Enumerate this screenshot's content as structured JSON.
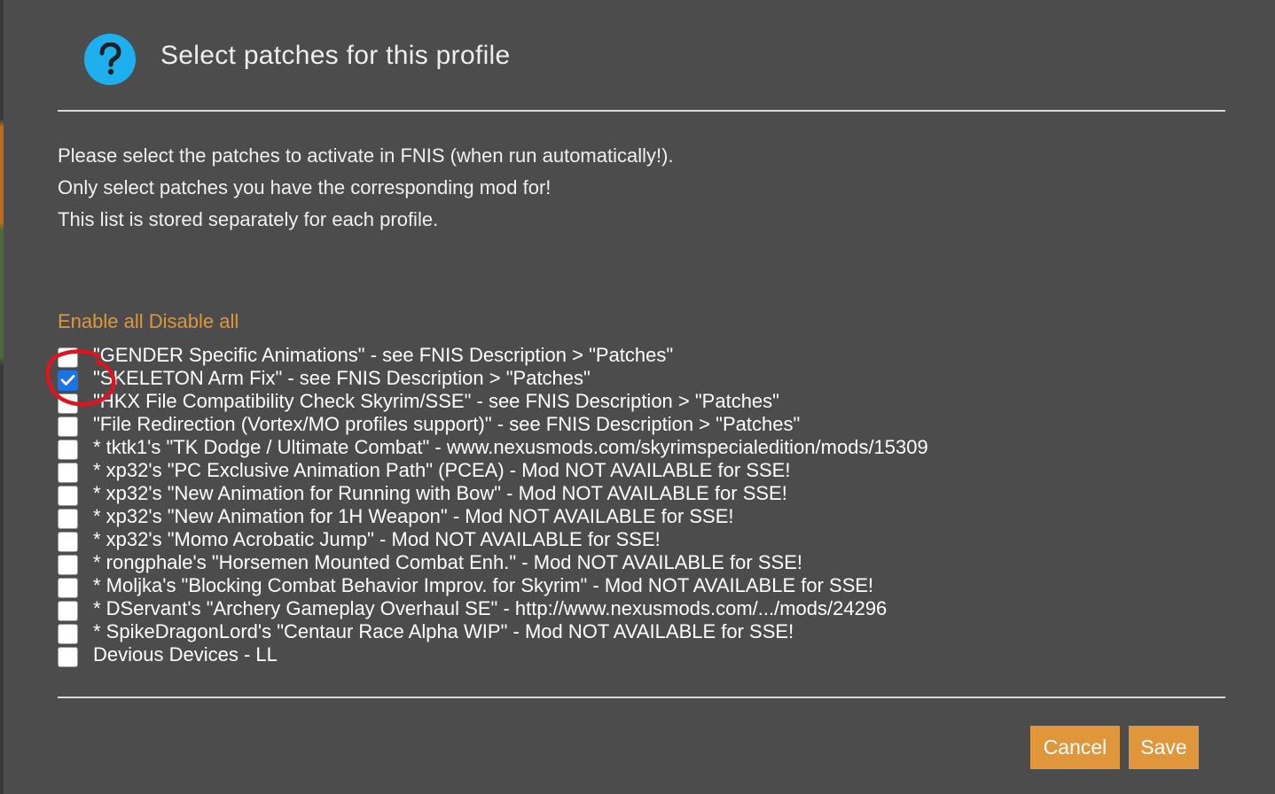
{
  "dialog": {
    "title": "Select patches for this profile",
    "icon": "question-mark-icon",
    "accent_color": "#1eb0ee"
  },
  "description": {
    "line1": "Please select the patches to activate in FNIS (when run automatically!).",
    "line2": "Only select patches you have the corresponding mod for!",
    "line3": "This list is stored separately for each profile."
  },
  "links": {
    "enable_all": "Enable all",
    "disable_all": "Disable all",
    "color": "#e0973c"
  },
  "patches": [
    {
      "label": "\"GENDER Specific Animations\" - see FNIS Description > \"Patches\"",
      "checked": false
    },
    {
      "label": "\"SKELETON Arm Fix\" - see FNIS Description > \"Patches\"",
      "checked": true
    },
    {
      "label": "\"HKX File Compatibility Check Skyrim/SSE\" - see FNIS Description > \"Patches\"",
      "checked": false
    },
    {
      "label": "\"File Redirection (Vortex/MO profiles support)\" - see FNIS Description > \"Patches\"",
      "checked": false
    },
    {
      "label": "* tktk1's \"TK Dodge / Ultimate Combat\" - www.nexusmods.com/skyrimspecialedition/mods/15309",
      "checked": false
    },
    {
      "label": "* xp32's \"PC Exclusive Animation Path\" (PCEA) - Mod NOT AVAILABLE for SSE!",
      "checked": false
    },
    {
      "label": "* xp32's \"New Animation for Running with Bow\" - Mod NOT AVAILABLE for SSE!",
      "checked": false
    },
    {
      "label": "* xp32's \"New Animation for 1H Weapon\" - Mod NOT AVAILABLE for SSE!",
      "checked": false
    },
    {
      "label": "* xp32's \"Momo Acrobatic Jump\" - Mod NOT AVAILABLE for SSE!",
      "checked": false
    },
    {
      "label": "* rongphale's \"Horsemen Mounted Combat Enh.\" - Mod NOT AVAILABLE for SSE!",
      "checked": false
    },
    {
      "label": "* Moljka's \"Blocking Combat Behavior Improv. for Skyrim\" - Mod NOT AVAILABLE for SSE!",
      "checked": false
    },
    {
      "label": "* DServant's \"Archery Gameplay Overhaul SE\" - http://www.nexusmods.com/.../mods/24296",
      "checked": false
    },
    {
      "label": "* SpikeDragonLord's \"Centaur Race Alpha WIP\" - Mod NOT AVAILABLE for SSE!",
      "checked": false
    },
    {
      "label": "Devious Devices - LL",
      "checked": false
    }
  ],
  "buttons": {
    "cancel": "Cancel",
    "save": "Save",
    "color": "#e0973c"
  },
  "annotation": {
    "shape": "red-circle",
    "color": "#e0141e"
  }
}
